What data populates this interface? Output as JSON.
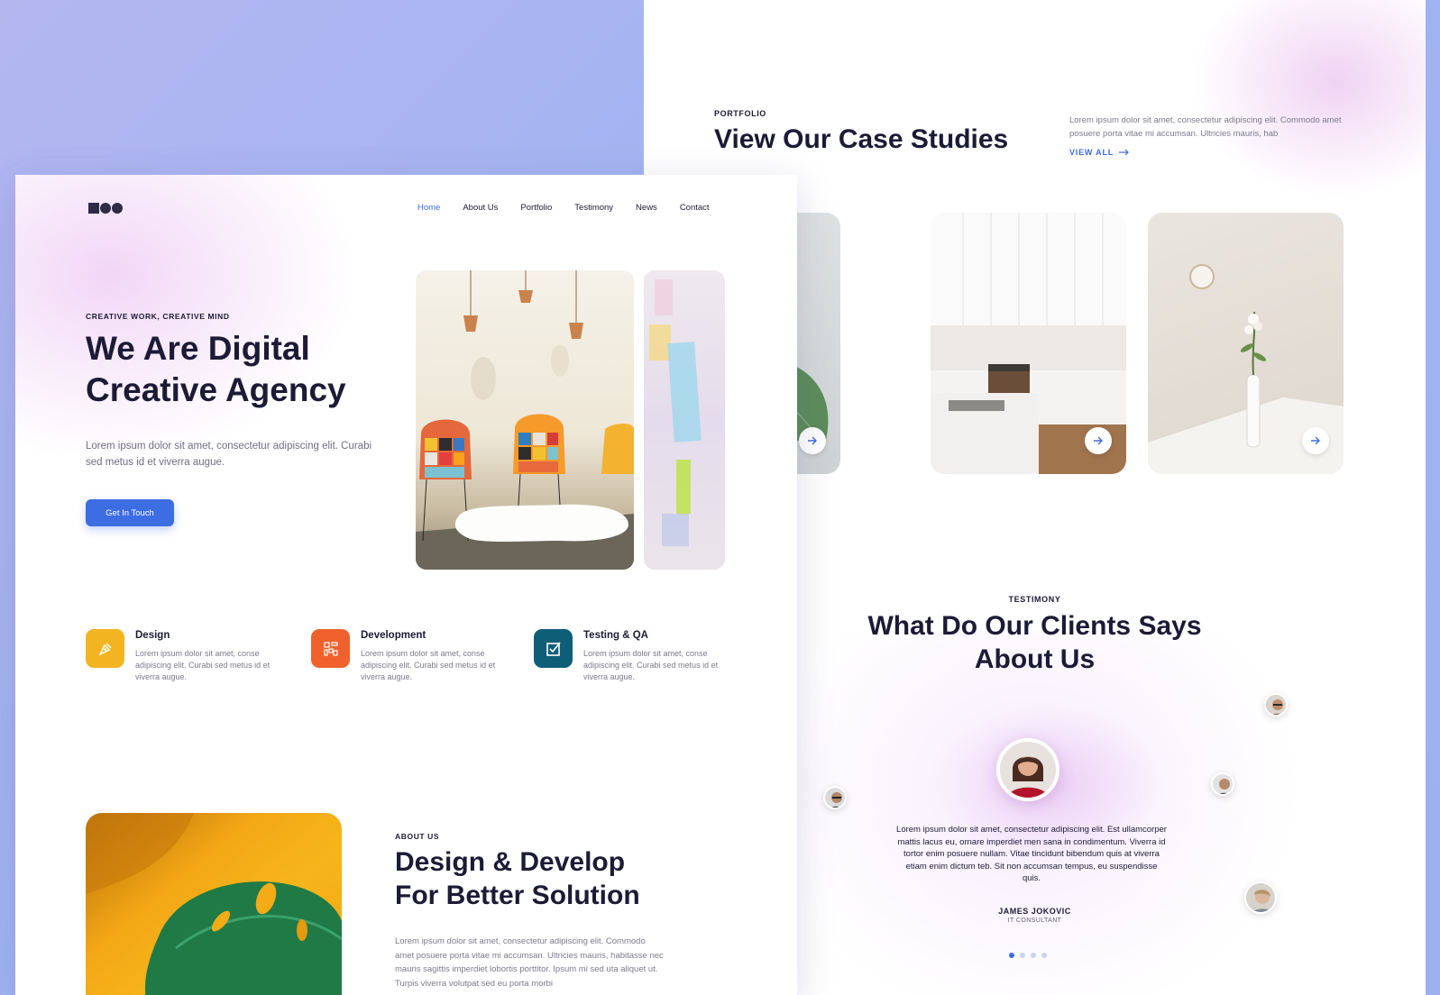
{
  "portfolio": {
    "eyebrow": "PORTFOLIO",
    "title": "View Our Case Studies",
    "description": "Lorem ipsum dolor sit amet, consectetur adipiscing elit. Commodo amet posuere porta vitae mi accumsan. Ultricies mauris, hab",
    "view_all": "VIEW ALL",
    "cards": [
      {
        "image": "leaf-with-water-drops",
        "button_icon": "arrow-right-icon"
      },
      {
        "image": "white-kitchen",
        "button_icon": "arrow-right-icon"
      },
      {
        "image": "white-flower-vase-table",
        "button_icon": "arrow-right-icon"
      }
    ]
  },
  "testimony": {
    "eyebrow": "TESTIMONY",
    "title_line1": "What Do Our Clients Says",
    "title_line2": "About Us",
    "quote": "Lorem ipsum dolor sit amet, consectetur adipiscing elit. Est ullamcorper mattis lacus eu, ornare imperdiet men sana in condimentum. Viverra id tortor enim posuere nullam. Vitae tincidunt bibendum quis at viverra etiam enim dictum teb. Sit non accumsan tempus, eu suspendisse quis.",
    "name": "JAMES JOKOVIC",
    "role": "IT CONSULTANT",
    "dots": 4,
    "active_dot": 0
  },
  "header": {
    "nav": [
      "Home",
      "About Us",
      "Portfolio",
      "Testimony",
      "News",
      "Contact"
    ],
    "active": "Home"
  },
  "hero": {
    "eyebrow": "CREATIVE WORK, CREATIVE MIND",
    "title_line1": "We Are Digital",
    "title_line2": "Creative Agency",
    "description": "Lorem ipsum dolor sit amet, consectetur adipiscing elit. Curabi sed metus id et viverra augue.",
    "cta": "Get In Touch"
  },
  "services": [
    {
      "title": "Design",
      "description": "Lorem ipsum dolor sit amet, conse adipiscing elit. Curabi sed metus id et viverra augue.",
      "icon": "pen-tool-icon",
      "color": "#F2B521"
    },
    {
      "title": "Development",
      "description": "Lorem ipsum dolor sit amet, conse adipiscing elit. Curabi sed metus id et viverra augue.",
      "icon": "code-blocks-icon",
      "color": "#F0612E"
    },
    {
      "title": "Testing & QA",
      "description": "Lorem ipsum dolor sit amet, conse adipiscing elit. Curabi sed metus id et viverra augue.",
      "icon": "checkbox-icon",
      "color": "#0E5E78"
    }
  ],
  "about": {
    "eyebrow": "ABOUT US",
    "title_line1": "Design & Develop",
    "title_line2": "For Better Solution",
    "description": "Lorem ipsum dolor sit amet, consectetur adipiscing elit. Commodo amet posuere porta vitae mi accumsan. Ultricies mauris, habitasse nec mauris sagittis imperdiet lobortis porttitor. Ipsum mi sed uta aliquet ut. Turpis viverra volutpat sed eu porta morbi"
  },
  "colors": {
    "accent": "#3D6DE3",
    "heading": "#1C1B36",
    "body": "#7B7A8C"
  }
}
